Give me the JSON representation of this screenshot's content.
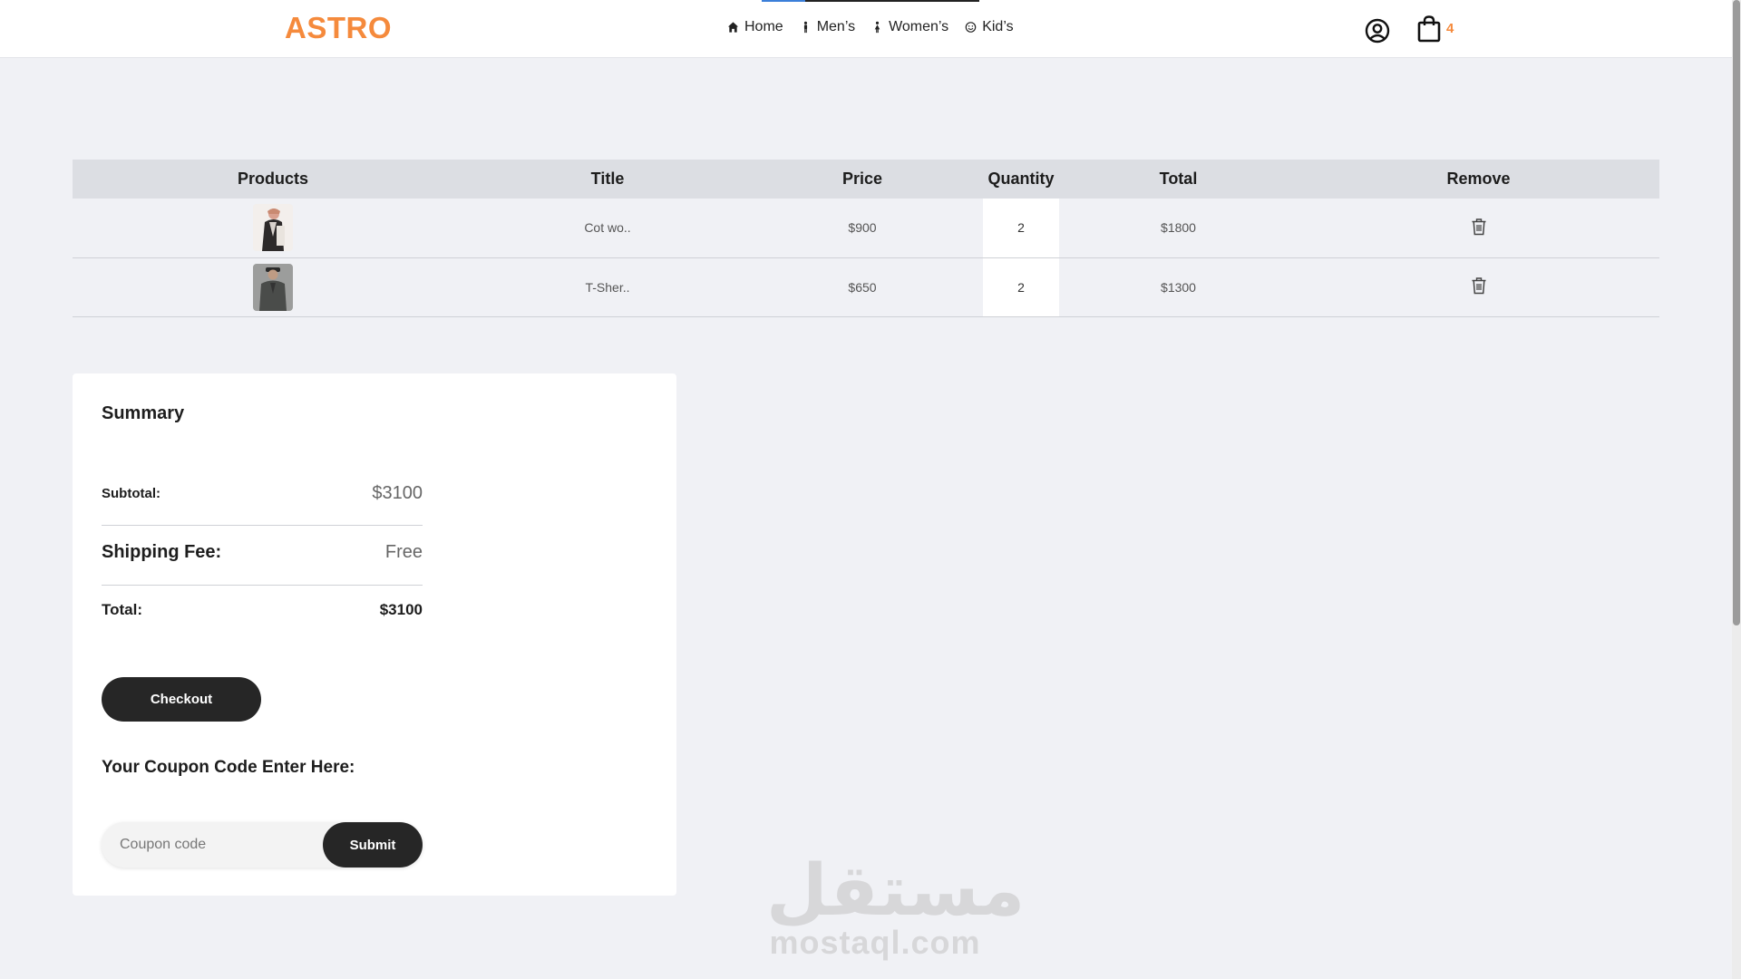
{
  "header": {
    "logo": "ASTRO",
    "nav": [
      {
        "label": "Home",
        "icon": "home-icon"
      },
      {
        "label": "Men’s",
        "icon": "man-icon"
      },
      {
        "label": "Women’s",
        "icon": "woman-icon"
      },
      {
        "label": "Kid’s",
        "icon": "smile-icon"
      }
    ],
    "cart_count": "4",
    "user_icon": "user-circle-icon",
    "cart_icon": "shopping-bag-icon"
  },
  "table": {
    "headers": [
      "Products",
      "Title",
      "Price",
      "Quantity",
      "Total",
      "Remove"
    ],
    "rows": [
      {
        "title": "Cot wo..",
        "price": "$900",
        "quantity": "2",
        "total": "$1800"
      },
      {
        "title": "T-Sher..",
        "price": "$650",
        "quantity": "2",
        "total": "$1300"
      }
    ]
  },
  "summary": {
    "title": "Summary",
    "subtotal_label": "Subtotal:",
    "subtotal_value": "$3100",
    "shipping_label": "Shipping Fee:",
    "shipping_value": "Free",
    "total_label": "Total:",
    "total_value": "$3100",
    "checkout_label": "Checkout",
    "coupon_title": "Your Coupon Code Enter Here:",
    "coupon_placeholder": "Coupon code",
    "submit_label": "Submit"
  },
  "watermark": {
    "arabic": "مستقل",
    "latin": "mostaql.com"
  },
  "colors": {
    "accent": "#f58a3c",
    "button_dark": "#262626",
    "page_bg": "#f0f1f5",
    "table_header_bg": "#dcdee3"
  }
}
